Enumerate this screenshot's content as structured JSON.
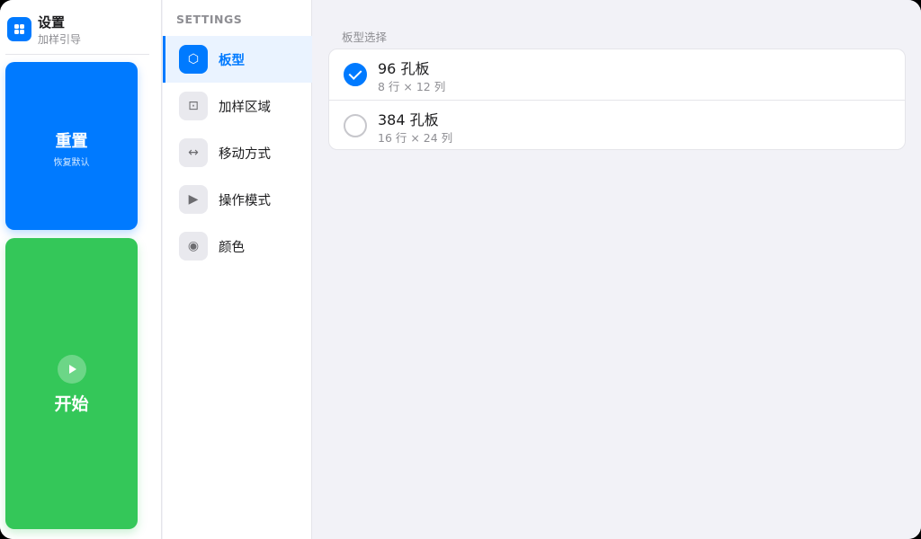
{
  "app": {
    "title": "设置",
    "subtitle": "加样引导",
    "icon": "grid-icon",
    "accent": "#007aff"
  },
  "actions": {
    "reset": {
      "title": "重置",
      "subtitle": "恢复默认",
      "color": "#007aff"
    },
    "start": {
      "title": "开始",
      "icon": "play-icon",
      "color": "#34c759"
    }
  },
  "settings": {
    "heading": "SETTINGS",
    "items": [
      {
        "label": "板型",
        "icon": "hexagon-icon",
        "glyph": "⬡",
        "active": true
      },
      {
        "label": "加样区域",
        "icon": "dotted-square-icon",
        "glyph": "⊡",
        "active": false
      },
      {
        "label": "移动方式",
        "icon": "arrows-horizontal-icon",
        "glyph": "↔",
        "active": false
      },
      {
        "label": "操作模式",
        "icon": "play-icon",
        "glyph": "▶",
        "active": false
      },
      {
        "label": "颜色",
        "icon": "color-circle-icon",
        "glyph": "◉",
        "active": false
      }
    ]
  },
  "plate_selection": {
    "label": "板型选择",
    "options": [
      {
        "title": "96 孔板",
        "subtitle": "8 行 × 12 列",
        "selected": true
      },
      {
        "title": "384 孔板",
        "subtitle": "16 行 × 24 列",
        "selected": false
      }
    ]
  }
}
